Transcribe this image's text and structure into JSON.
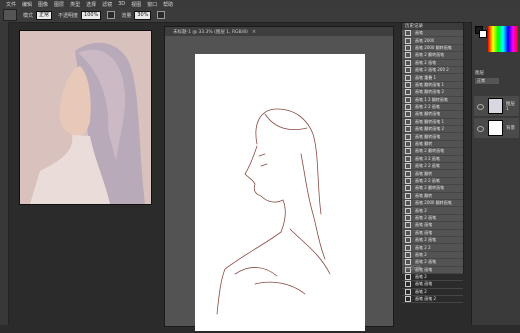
{
  "menubar": {
    "items": [
      "文件",
      "编辑",
      "图像",
      "图层",
      "类型",
      "选择",
      "滤镜",
      "3D",
      "视图",
      "窗口",
      "帮助"
    ]
  },
  "options": {
    "mode_label": "模式",
    "mode_value": "正常",
    "opacity_label": "不透明度",
    "opacity_value": "100%",
    "flow_label": "流量",
    "flow_value": "30%"
  },
  "reference": {
    "label": "参考图"
  },
  "document": {
    "tab_title": "未标题-1 @ 33.3% (图层 1, RGB/8)",
    "close": "×"
  },
  "history": {
    "title": "历史记录",
    "items": [
      "画笔",
      "画笔 2000",
      "画笔 2000 翻转画笔",
      "画笔 2 翻转画笔",
      "画笔 2 画笔",
      "画笔 2 画笔 200 2",
      "画笔 重叠 1",
      "画笔 翻转画笔 1",
      "画笔 翻转画笔 2",
      "画笔 1 2 翻转画笔",
      "画笔 2 2 画笔",
      "画笔 翻转画笔",
      "画笔 翻转画笔 1",
      "画笔 翻转画笔 2",
      "画笔 翻转画笔",
      "画笔 翻转",
      "画笔 2 翻转画笔",
      "画笔 3 2 画笔",
      "画笔 2 2 画笔",
      "画笔 翻转",
      "画笔 2 2 画笔",
      "画笔 2 翻转画笔",
      "画笔 翻转",
      "画笔 2000 翻转画笔",
      "画笔 2",
      "画笔 2 画笔",
      "画笔 画笔",
      "画笔 画笔",
      "画笔 2 画笔",
      "画笔 2 2",
      "画笔 2",
      "画笔 2 画笔",
      "画笔 画笔",
      "画笔 2",
      "画笔 画笔",
      "画笔 2",
      "画笔 画笔 2"
    ],
    "footer": "历史记录"
  },
  "layers": {
    "panel_label": "图层",
    "blend": "正常",
    "opacity": "不透明度",
    "layer1": "图层 1",
    "bg": "背景"
  },
  "colors": {
    "fg": "#1a1a1a",
    "bg": "#ffffff",
    "accent": "#c0392b"
  }
}
